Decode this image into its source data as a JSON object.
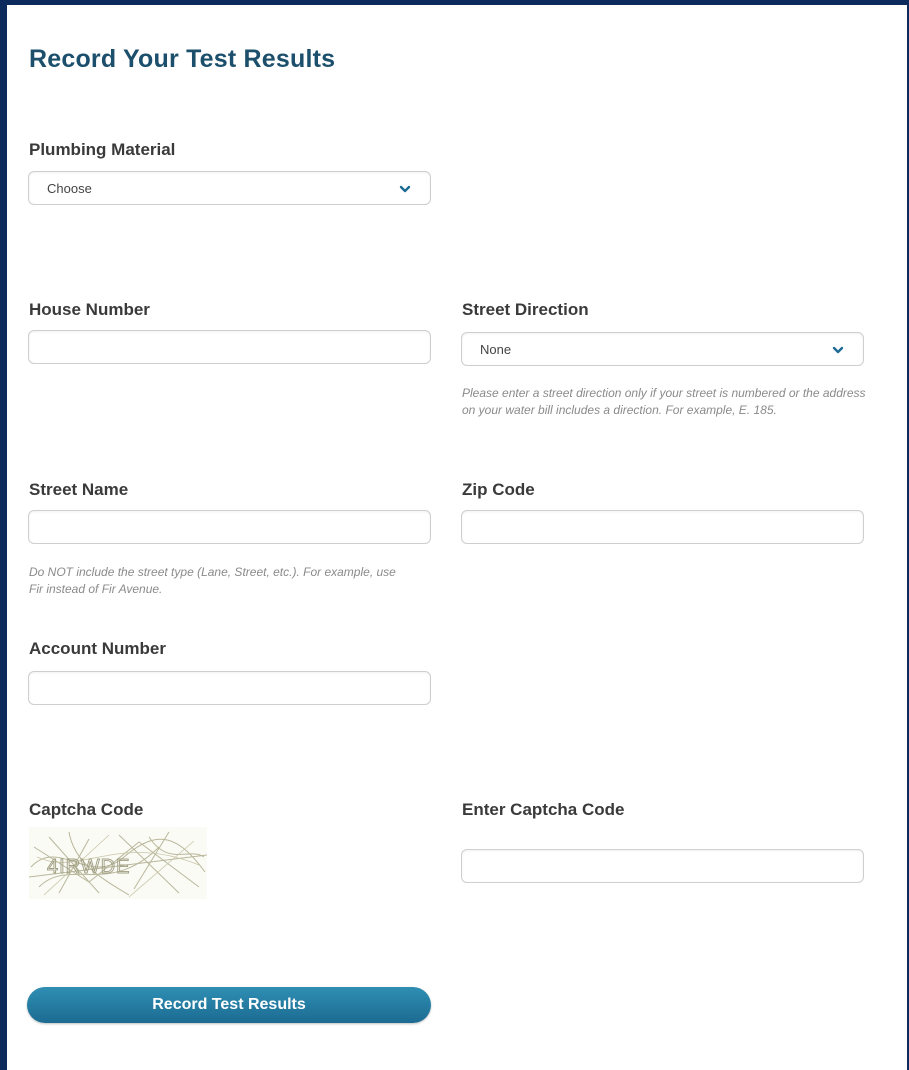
{
  "page": {
    "title": "Record Your Test Results"
  },
  "plumbing": {
    "label": "Plumbing Material",
    "selected": "Choose"
  },
  "house_number": {
    "label": "House Number",
    "value": ""
  },
  "street_direction": {
    "label": "Street Direction",
    "selected": "None",
    "help": "Please enter a street direction only if your street is numbered or the address on your water bill includes a direction. For example, E. 185."
  },
  "street_name": {
    "label": "Street Name",
    "value": "",
    "help": "Do NOT include the street type (Lane, Street, etc.). For example, use Fir instead of Fir Avenue."
  },
  "zip_code": {
    "label": "Zip Code",
    "value": ""
  },
  "account_number": {
    "label": "Account Number",
    "value": ""
  },
  "captcha": {
    "label": "Captcha Code",
    "image_text": "4IRWDE"
  },
  "enter_captcha": {
    "label": "Enter Captcha Code",
    "value": ""
  },
  "submit": {
    "label": "Record Test Results"
  },
  "colors": {
    "accent": "#1c6b92",
    "title": "#1b4f6b",
    "frame": "#0d2a5c"
  },
  "icons": {
    "select_arrow": "chevron-down-icon"
  }
}
